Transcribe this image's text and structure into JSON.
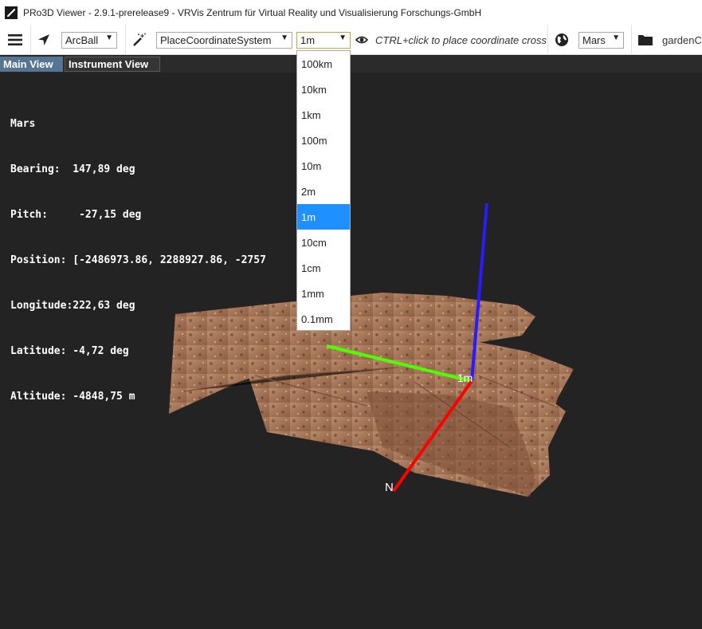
{
  "window": {
    "title": "PRo3D Viewer - 2.9.1-prerelease9 - VRVis Zentrum für Virtual Reality und Visualisierung Forschungs-GmbH"
  },
  "toolbar": {
    "camera_mode": "ArcBall",
    "interaction_mode": "PlaceCoordinateSystem",
    "scale": "1m",
    "hint": "CTRL+click to place coordinate cross",
    "planet": "Mars",
    "folder_label": "gardenC"
  },
  "tabs": [
    {
      "label": "Main View",
      "active": true
    },
    {
      "label": "Instrument View",
      "active": false
    }
  ],
  "info": {
    "planet": "Mars",
    "bearing": "Bearing:  147,89 deg",
    "pitch": "Pitch:     -27,15 deg",
    "position": "Position: [-2486973.86, 2288927.86, -2757",
    "longitude": "Longitude:222,63 deg",
    "latitude": "Latitude: -4,72 deg",
    "altitude": "Altitude: -4848,75 m"
  },
  "scale_menu": {
    "options": [
      "100km",
      "10km",
      "1km",
      "100m",
      "10m",
      "2m",
      "1m",
      "10cm",
      "1cm",
      "1mm",
      "0.1mm"
    ],
    "selected": "1m"
  },
  "axes": {
    "x_color": "#ff0000",
    "y_color": "#4cff00",
    "z_color": "#2a1aff",
    "north_label": "N",
    "scale_label": "1m"
  },
  "colors": {
    "accent": "#1e90ff",
    "tab_active": "#557592",
    "background": "#232323",
    "terrain": "#a8795a"
  }
}
